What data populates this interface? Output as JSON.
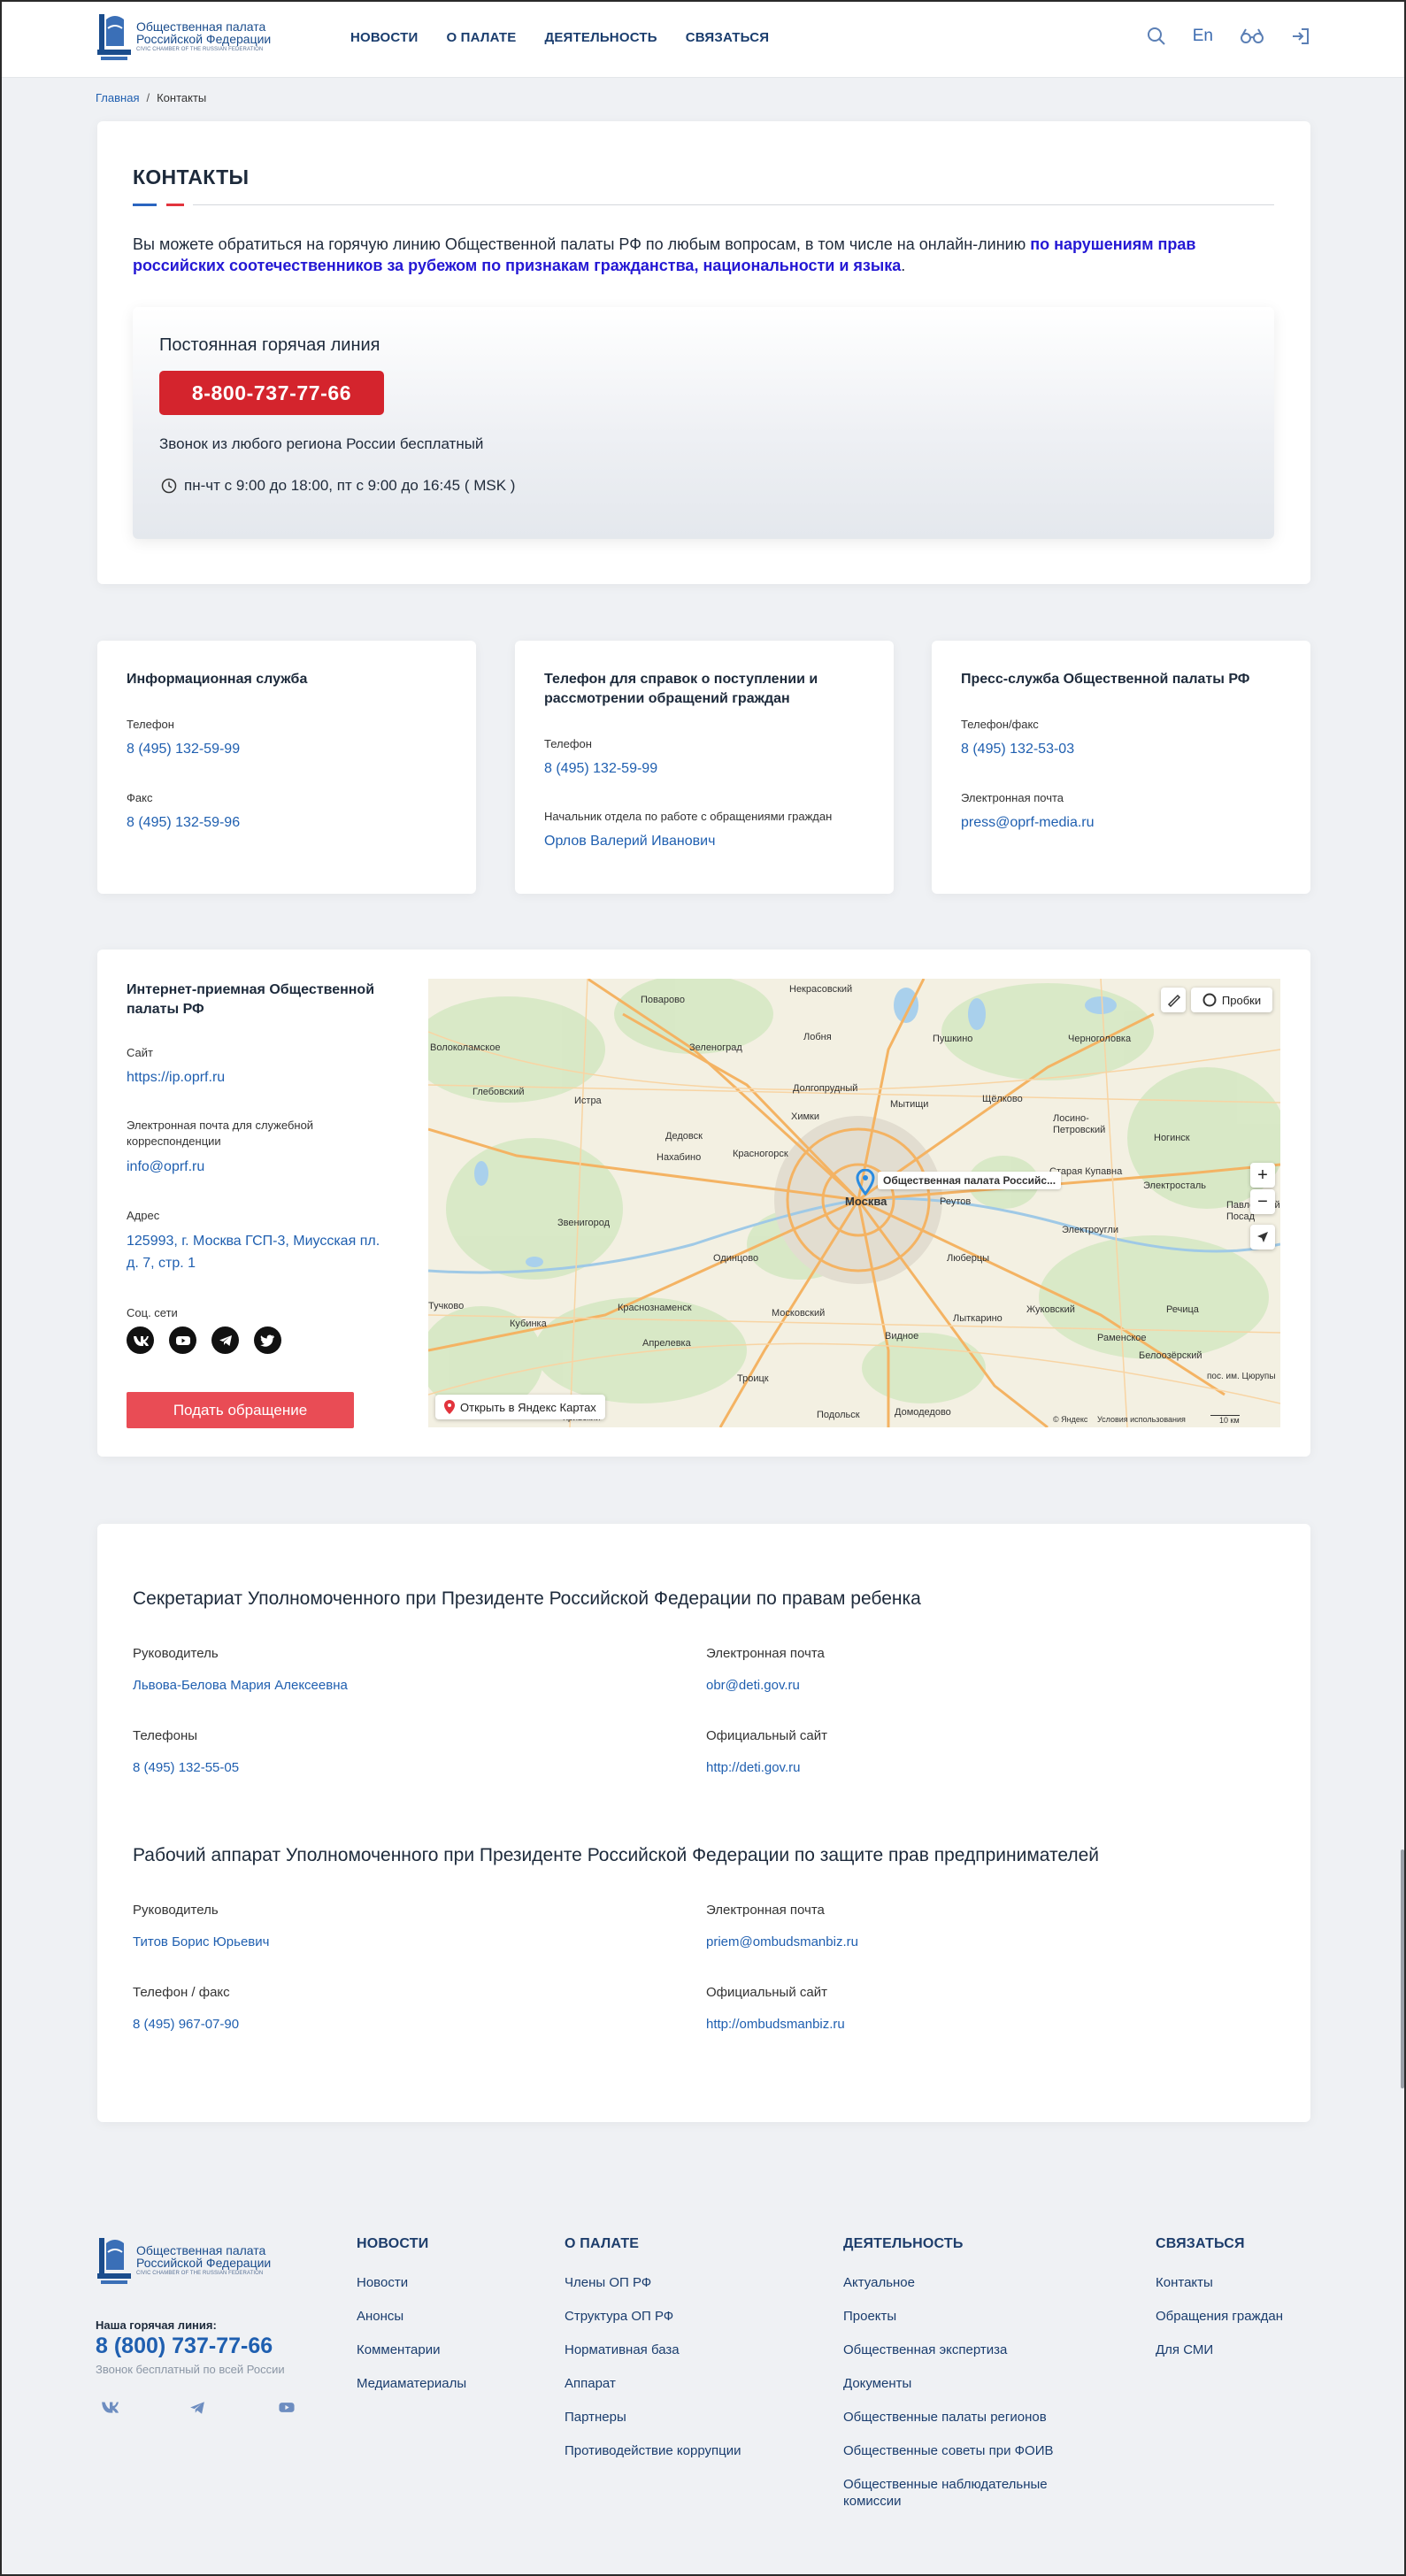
{
  "header": {
    "logo": {
      "line1": "Общественная палата",
      "line2": "Российской Федерации",
      "line3": "CIVIC CHAMBER OF THE RUSSIAN FEDERATION"
    },
    "nav": [
      "НОВОСТИ",
      "О ПАЛАТЕ",
      "ДЕЯТЕЛЬНОСТЬ",
      "СВЯЗАТЬСЯ"
    ],
    "lang": "En",
    "icons": [
      "search-icon",
      "accessibility-glasses-icon",
      "login-icon"
    ]
  },
  "breadcrumb": {
    "home": "Главная",
    "sep": "/",
    "current": "Контакты"
  },
  "contacts": {
    "title": "КОНТАКТЫ",
    "intro_text": "Вы можете обратиться на горячую линию Общественной палаты РФ по любым вопросам, в том числе на онлайн-линию ",
    "intro_bold": "по нарушениям прав российских соотечественников за рубежом по признакам гражданства, национальности и языка",
    "intro_end": ".",
    "hotline": {
      "title": "Постоянная горячая линия",
      "phone": "8-800-737-77-66",
      "free": "Звонок из любого региона России бесплатный",
      "hours": "пн-чт с 9:00 до 18:00, пт с 9:00 до 16:45 ( MSK )"
    }
  },
  "info_cards": [
    {
      "title": "Информационная служба",
      "label1": "Телефон",
      "value1": "8 (495) 132-59-99",
      "label2": "Факс",
      "value2": "8 (495) 132-59-96"
    },
    {
      "title": "Телефон для справок о поступлении и рассмотрении обращений граждан",
      "label1": "Телефон",
      "value1": "8 (495) 132-59-99",
      "label2": "Начальник отдела по работе с обращениями граждан",
      "value2": "Орлов Валерий Иванович"
    },
    {
      "title": "Пресс-служба Общественной палаты РФ",
      "label1": "Телефон/факс",
      "value1": "8 (495) 132-53-03",
      "label2": "Электронная почта",
      "value2": "press@oprf-media.ru"
    }
  ],
  "internet_reception": {
    "title": "Интернет-приемная Общественной палаты РФ",
    "site_label": "Сайт",
    "site": "https://ip.oprf.ru",
    "email_label": "Электронная почта для служебной корреспонденции",
    "email": "info@oprf.ru",
    "address_label": "Адрес",
    "address": "125993, г. Москва ГСП-3, Миусская пл. д. 7, стр. 1",
    "social_label": "Соц. сети",
    "socials": [
      "vk-icon",
      "youtube-icon",
      "telegram-icon",
      "twitter-icon"
    ],
    "button": "Подать обращение"
  },
  "map": {
    "traffic": "Пробки",
    "marker": "Общественная палата Российс...",
    "open_link": "Открыть в Яндекс Картах",
    "copyright": "© Яндекс",
    "terms": "Условия использования",
    "scale": "10 км",
    "zoom_in": "+",
    "zoom_out": "−",
    "places": [
      "Поварово",
      "Некрасовский",
      "Пушкино",
      "Черноголовка",
      "Зеленоград",
      "Лобня",
      "Мытищи",
      "Щёлково",
      "Глебовский",
      "Истра",
      "Долгопрудный",
      "Химки",
      "Лосино-Петровский",
      "Ногинск",
      "Дедовск",
      "Нахабино",
      "Красногорск",
      "Старая Купавна",
      "Электросталь",
      "Звенигород",
      "Москва",
      "Реутов",
      "Павловский Посад",
      "Электроугли",
      "Одинцово",
      "Люберцы",
      "Жуковский",
      "Раменское",
      "Краснознаменск",
      "Кубинка",
      "Апрелевка",
      "Московский",
      "Видное",
      "Лыткарино",
      "Троицк",
      "Подольск",
      "Домодедово",
      "Белоозёрский",
      "Тучково",
      "Речица",
      "Волоколамское",
      "пос. им. Цюрупы",
      "Кривский"
    ]
  },
  "ombudsmen": [
    {
      "title": "Секретариат Уполномоченного при Президенте Российской Федерации по правам ребенка",
      "head_label": "Руководитель",
      "head": "Львова-Белова Мария Алексеевна",
      "email_label": "Электронная почта",
      "email": "obr@deti.gov.ru",
      "phone_label": "Телефоны",
      "phone": "8 (495) 132-55-05",
      "site_label": "Официальный сайт",
      "site": "http://deti.gov.ru"
    },
    {
      "title": "Рабочий аппарат Уполномоченного при Президенте Российской Федерации по защите прав предпринимателей",
      "head_label": "Руководитель",
      "head": "Титов Борис Юрьевич",
      "email_label": "Электронная почта",
      "email": "priem@ombudsmanbiz.ru",
      "phone_label": "Телефон / факс",
      "phone": "8 (495) 967-07-90",
      "site_label": "Официальный сайт",
      "site": "http://ombudsmanbiz.ru"
    }
  ],
  "footer": {
    "hotline_label": "Наша горячая линия:",
    "hotline_phone": "8 (800) 737-77-66",
    "hotline_free": "Звонок бесплатный по всей России",
    "socials": [
      "vk-icon",
      "telegram-icon",
      "youtube-icon"
    ],
    "columns": [
      {
        "title": "НОВОСТИ",
        "links": [
          "Новости",
          "Анонсы",
          "Комментарии",
          "Медиаматериалы"
        ]
      },
      {
        "title": "О ПАЛАТЕ",
        "links": [
          "Члены ОП РФ",
          "Структура ОП РФ",
          "Нормативная база",
          "Аппарат",
          "Партнеры",
          "Противодействие коррупции"
        ]
      },
      {
        "title": "ДЕЯТЕЛЬНОСТЬ",
        "links": [
          "Актуальное",
          "Проекты",
          "Общественная экспертиза",
          "Документы",
          "Общественные палаты регионов",
          "Общественные советы при ФОИВ",
          "Общественные наблюдательные комиссии"
        ]
      },
      {
        "title": "СВЯЗАТЬСЯ",
        "links": [
          "Контакты",
          "Обращения граждан",
          "Для СМИ"
        ]
      }
    ]
  },
  "colors": {
    "brand_blue": "#1f5fb0",
    "hotline_red": "#d4242d",
    "button_red": "#e94c55",
    "bold_link": "#2418d4"
  }
}
